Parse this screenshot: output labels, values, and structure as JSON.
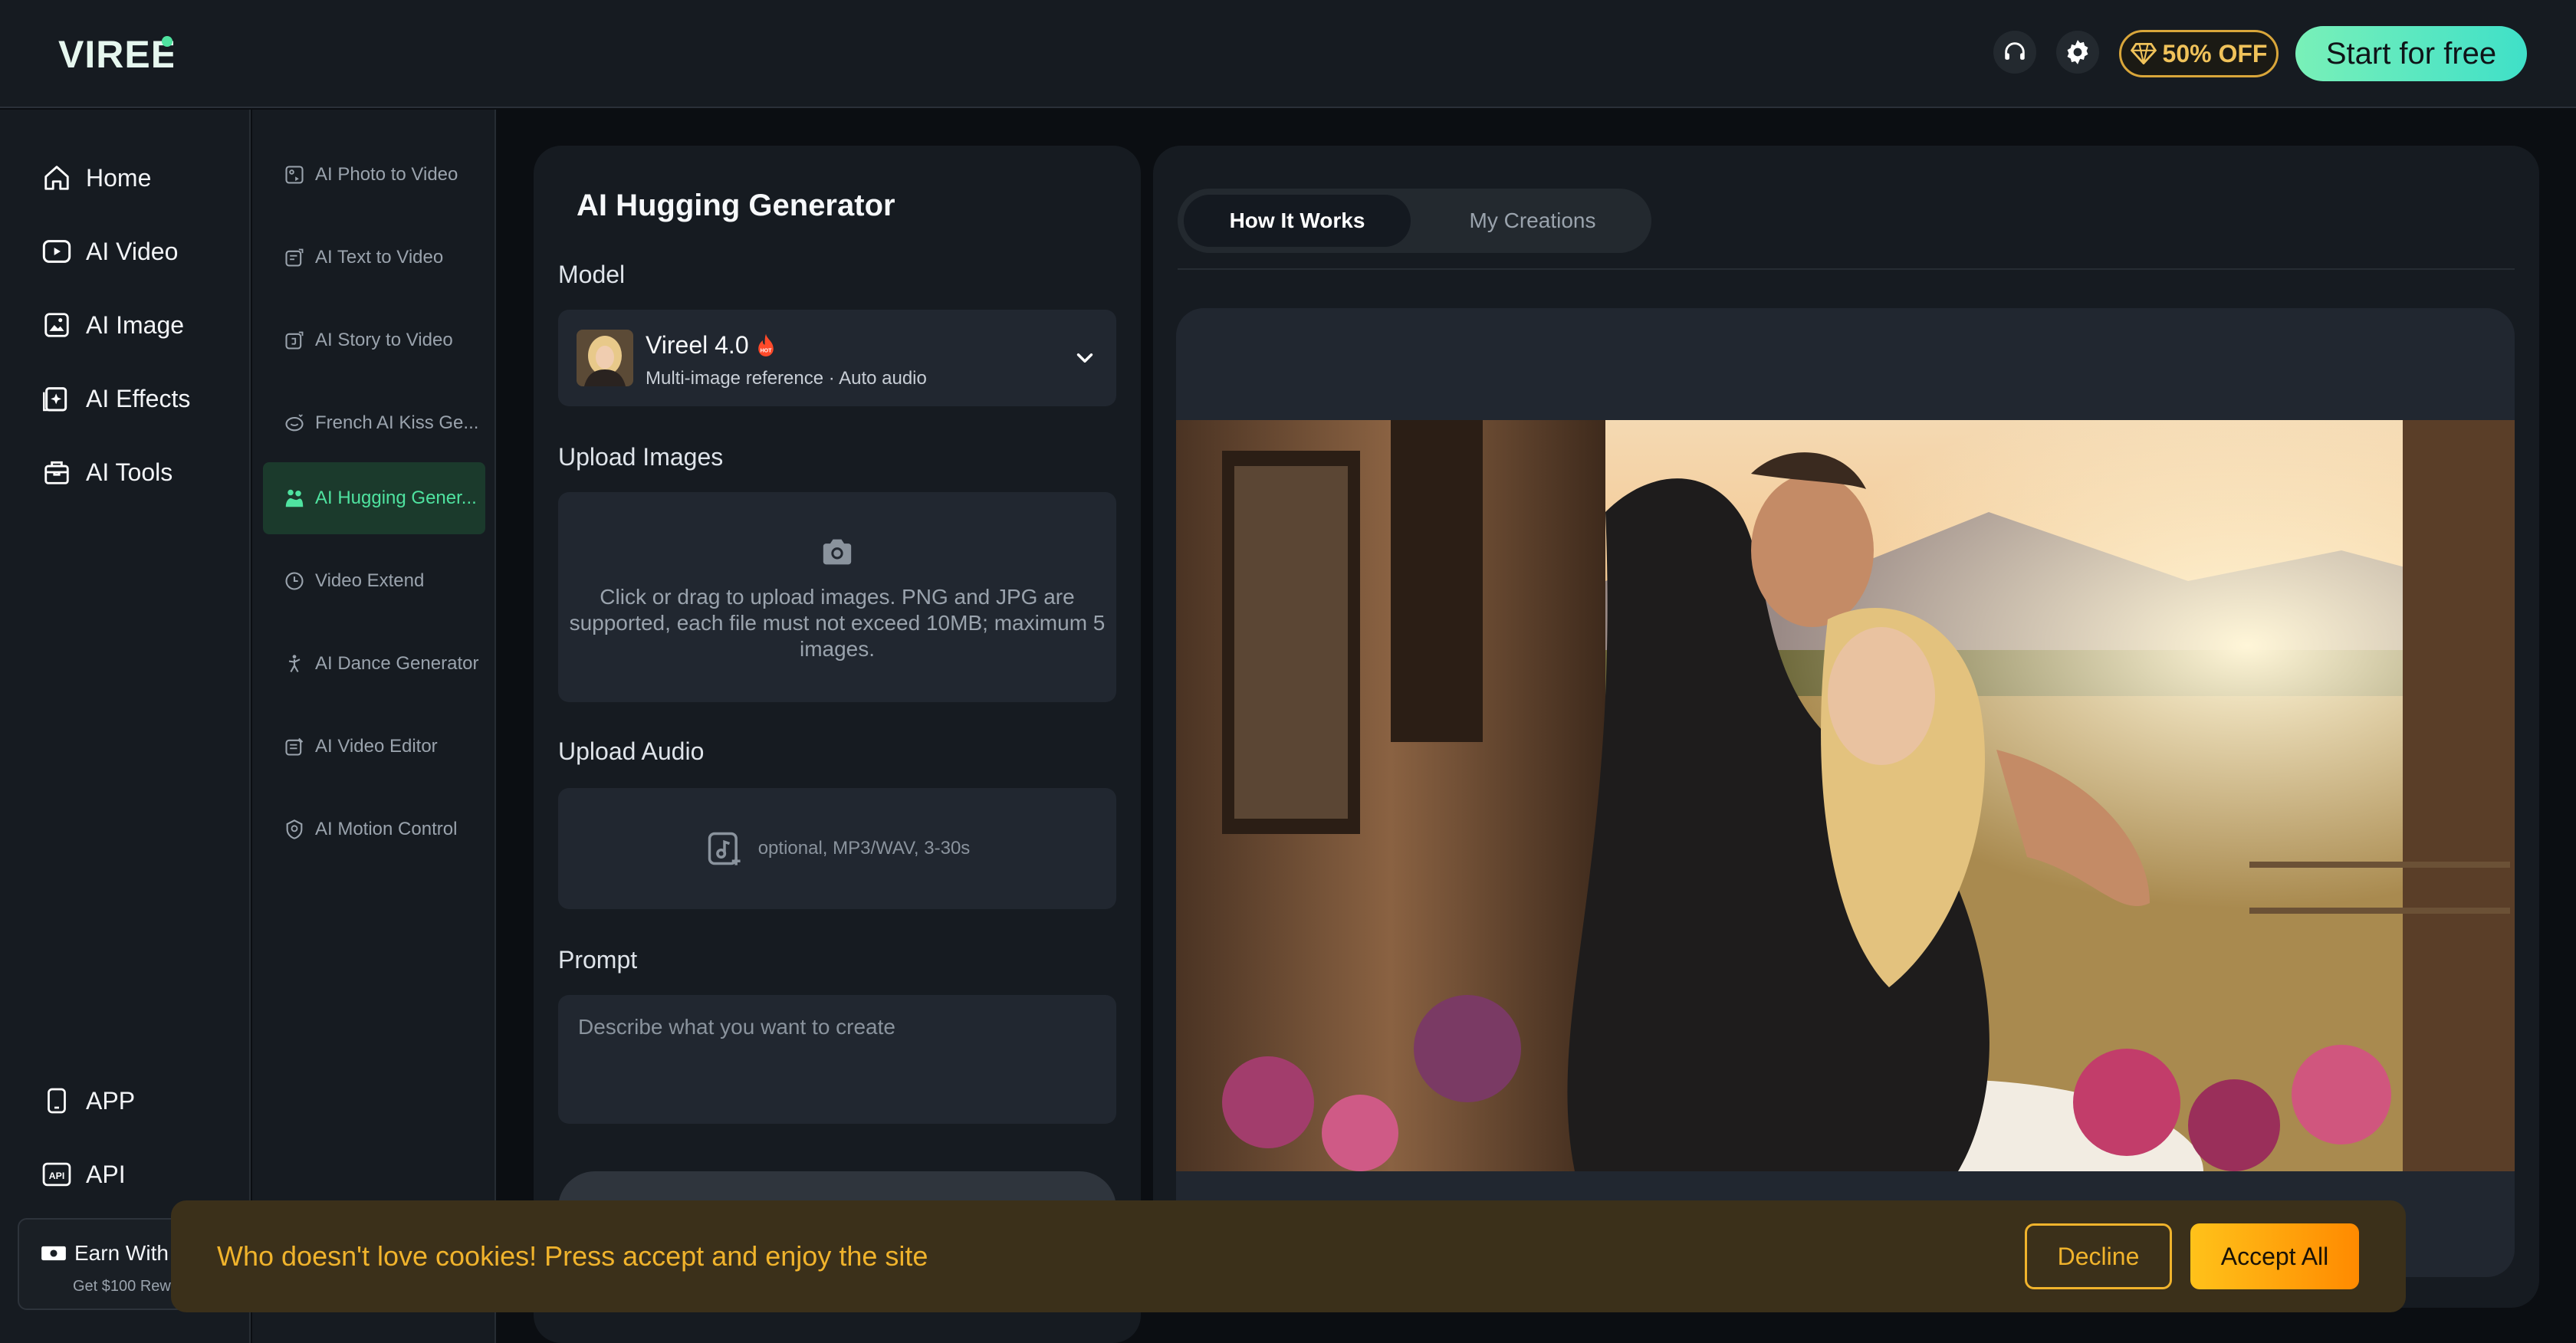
{
  "header": {
    "logo_text": "VIREEL",
    "offer_label": "50% OFF",
    "start_label": "Start for free",
    "icons": [
      "headset-icon",
      "settings-icon",
      "diamond-icon"
    ]
  },
  "nav": {
    "items": [
      {
        "label": "Home",
        "icon": "home-icon"
      },
      {
        "label": "AI Video",
        "icon": "video-play-icon"
      },
      {
        "label": "AI Image",
        "icon": "image-icon"
      },
      {
        "label": "AI Effects",
        "icon": "effects-icon"
      },
      {
        "label": "AI Tools",
        "icon": "toolbox-icon"
      }
    ],
    "bottom": [
      {
        "label": "APP",
        "icon": "phone-icon"
      },
      {
        "label": "API",
        "icon": "api-icon"
      }
    ],
    "earn": {
      "title": "Earn With",
      "subtitle": "Get $100 Rew"
    }
  },
  "subnav": {
    "items": [
      {
        "label": "AI Photo to Video"
      },
      {
        "label": "AI Text to Video"
      },
      {
        "label": "AI Story to Video"
      },
      {
        "label": "French AI Kiss Ge..."
      },
      {
        "label": "AI Hugging Gener..."
      },
      {
        "label": "Video Extend"
      },
      {
        "label": "AI Dance Generator"
      },
      {
        "label": "AI Video Editor"
      },
      {
        "label": "AI Motion Control"
      }
    ],
    "active_index": 4
  },
  "generator": {
    "title": "AI Hugging Generator",
    "model_label": "Model",
    "model": {
      "name": "Vireel 4.0",
      "badge": "HOT",
      "description": "Multi-image reference · Auto audio"
    },
    "upload_images_label": "Upload Images",
    "upload_images_hint": "Click or drag to upload images. PNG and JPG are supported, each file must not exceed 10MB; maximum 5 images.",
    "upload_audio_label": "Upload Audio",
    "upload_audio_hint": "optional, MP3/WAV, 3-30s",
    "prompt_label": "Prompt",
    "prompt_placeholder": "Describe what you want to create",
    "prompt_value": ""
  },
  "preview": {
    "tabs": [
      {
        "label": "How It Works",
        "active": true
      },
      {
        "label": "My Creations",
        "active": false
      }
    ]
  },
  "cookie": {
    "message": "Who doesn't love cookies! Press accept and enjoy the site",
    "decline_label": "Decline",
    "accept_label": "Accept All"
  },
  "colors": {
    "accent_green": "#4fe3a0",
    "start_gradient": "#79f0b8",
    "cookie_amber": "#f0b32c",
    "panel": "#161b21",
    "field": "#212730"
  }
}
